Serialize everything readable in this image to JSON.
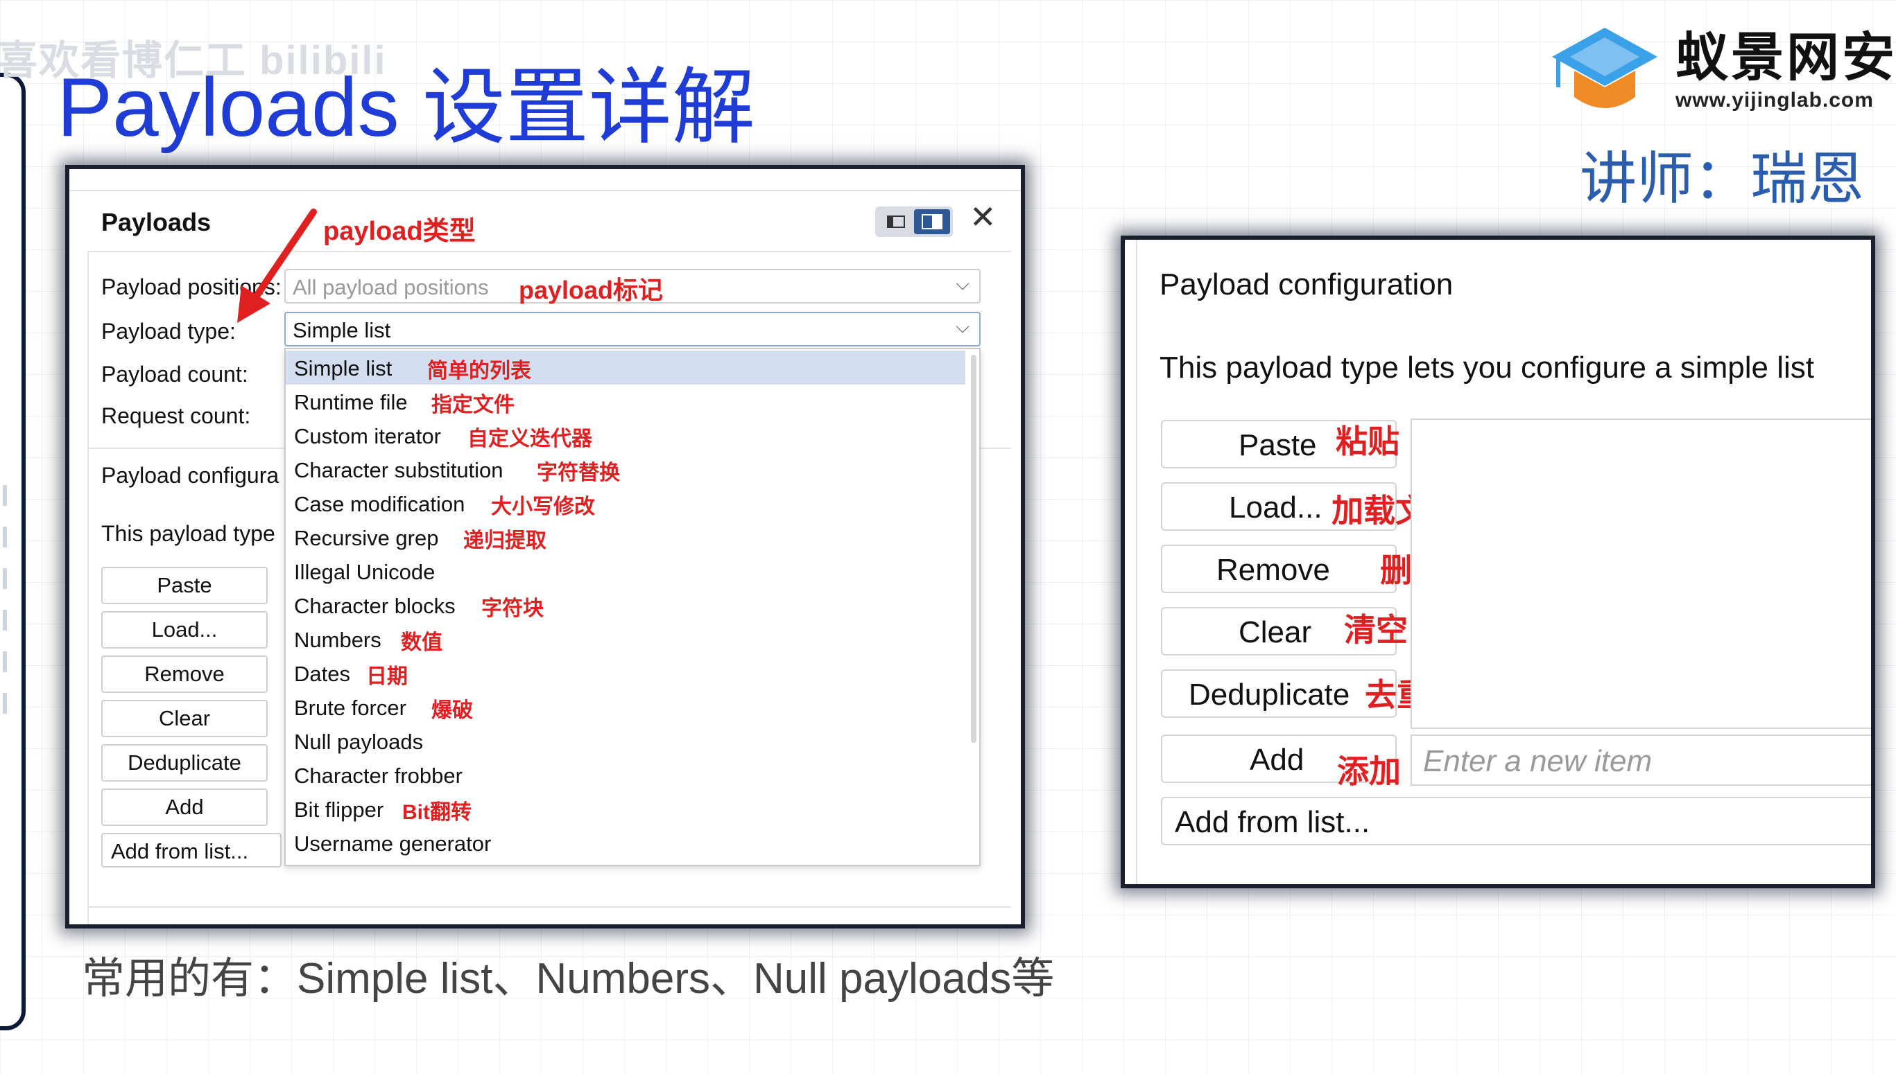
{
  "watermark": "喜欢看博仁工 bilibili",
  "slide_title": "Payloads 设置详解",
  "logo": {
    "name": "蚁景网安",
    "url": "www.yijinglab.com",
    "icon": "graduation-cap-icon"
  },
  "instructor": "讲师：瑞恩",
  "panel1": {
    "title": "Payloads",
    "fields": {
      "positions_label": "Payload positions:",
      "type_label": "Payload type:",
      "count_label": "Payload count:",
      "request_label": "Request count:"
    },
    "positions_value": "All payload positions",
    "type_value": "Simple list",
    "config_label": "Payload configura",
    "desc": "This payload type",
    "buttons": [
      "Paste",
      "Load...",
      "Remove",
      "Clear",
      "Deduplicate",
      "Add"
    ],
    "add_from_list": "Add from list...",
    "dropdown_options": [
      {
        "label": "Simple list",
        "note": "简单的列表",
        "selected": true
      },
      {
        "label": "Runtime file",
        "note": "指定文件"
      },
      {
        "label": "Custom iterator",
        "note": "自定义迭代器"
      },
      {
        "label": "Character substitution",
        "note": "字符替换"
      },
      {
        "label": "Case modification",
        "note": "大小写修改"
      },
      {
        "label": "Recursive grep",
        "note": "递归提取"
      },
      {
        "label": "Illegal Unicode",
        "note": ""
      },
      {
        "label": "Character blocks",
        "note": "字符块"
      },
      {
        "label": "Numbers",
        "note": "数值"
      },
      {
        "label": "Dates",
        "note": "日期"
      },
      {
        "label": "Brute forcer",
        "note": "爆破"
      },
      {
        "label": "Null payloads",
        "note": ""
      },
      {
        "label": "Character frobber",
        "note": ""
      },
      {
        "label": "Bit flipper",
        "note": "Bit翻转"
      },
      {
        "label": "Username generator",
        "note": ""
      }
    ],
    "annotations": {
      "type": "payload类型",
      "marker": "payload标记"
    }
  },
  "panel2": {
    "title": "Payload configuration",
    "desc": "This payload type lets you configure a simple list",
    "buttons": [
      {
        "label": "Paste",
        "note": "粘贴"
      },
      {
        "label": "Load...",
        "note": "加载文件"
      },
      {
        "label": "Remove",
        "note": "删除"
      },
      {
        "label": "Clear",
        "note": "清空"
      },
      {
        "label": "Deduplicate",
        "note": "去重"
      },
      {
        "label": "Add",
        "note": "添加"
      }
    ],
    "input_placeholder": "Enter a new item",
    "add_from_list": "Add from list..."
  },
  "caption": "常用的有：Simple list、Numbers、Null payloads等",
  "colors": {
    "title_blue": "#1f3dd6",
    "annotation_red": "#e02020",
    "selection": "#d3def0",
    "instructor_blue": "#2a5db0"
  }
}
